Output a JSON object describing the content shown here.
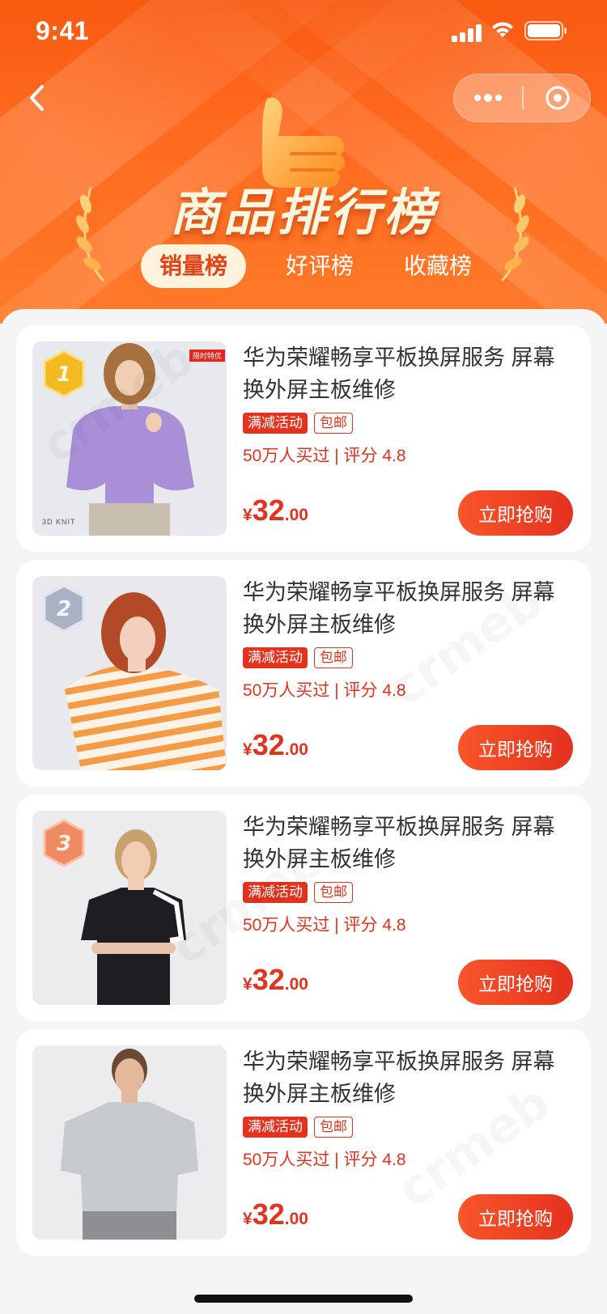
{
  "status_bar": {
    "time": "9:41"
  },
  "header": {
    "title": "商品排行榜",
    "tabs": [
      {
        "label": "销量榜",
        "active": true
      },
      {
        "label": "好评榜",
        "active": false
      },
      {
        "label": "收藏榜",
        "active": false
      }
    ]
  },
  "colors": {
    "header_orange": "#ff6a1e",
    "accent_red": "#e5321f",
    "active_tab_bg": "#fff3dd",
    "page_bg": "#f5f5f5"
  },
  "products": [
    {
      "rank": "1",
      "title": "华为荣耀畅享平板换屏服务 屏幕换外屏主板维修",
      "tags": [
        "满减活动",
        "包邮"
      ],
      "sales_info": "50万人买过 | 评分 4.8",
      "price": {
        "currency": "¥",
        "integer": "32",
        "decimal": ".00"
      },
      "buy_label": "立即抢购",
      "image_labels": {
        "promo": "限时特优",
        "brand": "3D KNIT"
      }
    },
    {
      "rank": "2",
      "title": "华为荣耀畅享平板换屏服务 屏幕换外屏主板维修",
      "tags": [
        "满减活动",
        "包邮"
      ],
      "sales_info": "50万人买过 | 评分 4.8",
      "price": {
        "currency": "¥",
        "integer": "32",
        "decimal": ".00"
      },
      "buy_label": "立即抢购"
    },
    {
      "rank": "3",
      "title": "华为荣耀畅享平板换屏服务 屏幕换外屏主板维修",
      "tags": [
        "满减活动",
        "包邮"
      ],
      "sales_info": "50万人买过 | 评分 4.8",
      "price": {
        "currency": "¥",
        "integer": "32",
        "decimal": ".00"
      },
      "buy_label": "立即抢购"
    },
    {
      "title": "华为荣耀畅享平板换屏服务 屏幕换外屏主板维修",
      "tags": [
        "满减活动",
        "包邮"
      ],
      "sales_info": "50万人买过 | 评分 4.8",
      "price": {
        "currency": "¥",
        "integer": "32",
        "decimal": ".00"
      },
      "buy_label": "立即抢购"
    }
  ],
  "watermark_text": "crmeb"
}
